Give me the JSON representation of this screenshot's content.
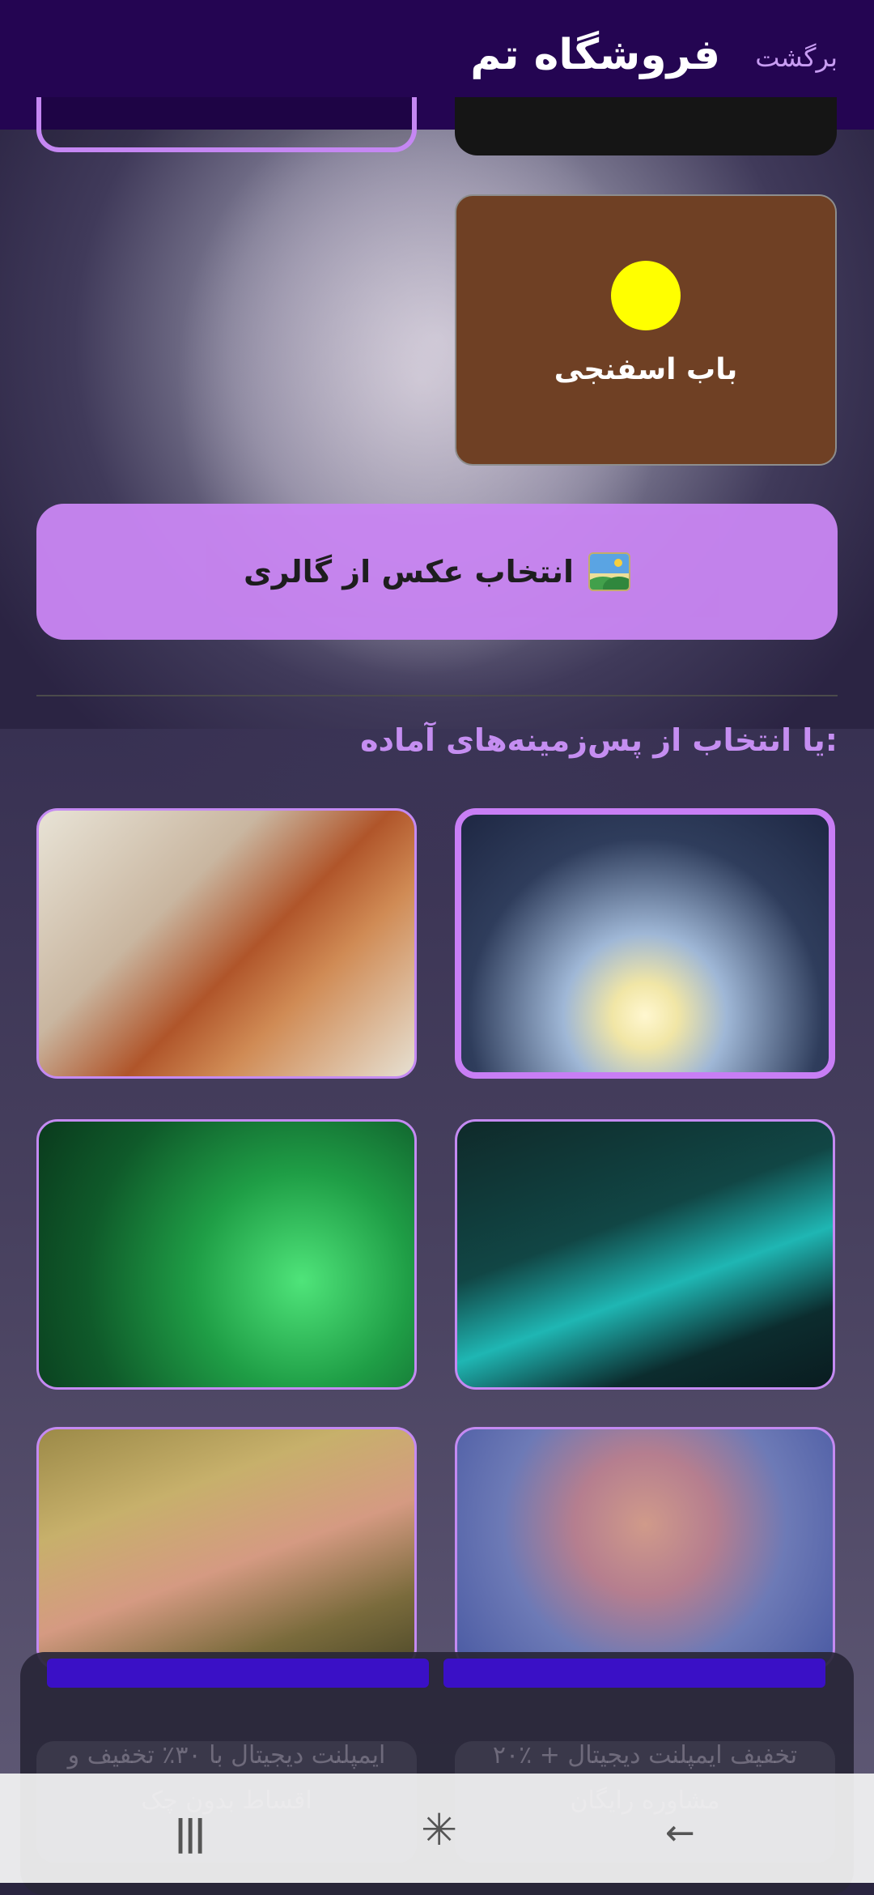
{
  "header": {
    "title": "فروشگاه تم",
    "back_label": "برگشت"
  },
  "theme_card": {
    "name": "باب اسفنجی",
    "accent_color": "#ffff00",
    "background_color": "#6f4024"
  },
  "gallery_button": {
    "label": "انتخاب عکس از گالری",
    "icon": "framed-picture-icon"
  },
  "backgrounds": {
    "subtitle": "یا انتخاب از پس‌زمینه‌های آماده:",
    "items": [
      {
        "alt": "braided-hair-woman"
      },
      {
        "alt": "moon-woman-glowing-orb",
        "selected": true
      },
      {
        "alt": "green-archer"
      },
      {
        "alt": "cyan-archer"
      },
      {
        "alt": "elf-with-lantern"
      },
      {
        "alt": "glowing-eyes-woman"
      }
    ]
  },
  "promo": {
    "left": "ایمپلنت دیجیتال با ۳۰٪ تخفیف و اقساط بدون چک",
    "right": "۲۰٪ تخفیف ایمپلنت دیجیتال + مشاوره رایگان"
  },
  "navbar": {
    "recent": "|||",
    "home": "✳",
    "back": "←"
  },
  "colors": {
    "header_bg": "#240552",
    "accent": "#c885f1"
  }
}
